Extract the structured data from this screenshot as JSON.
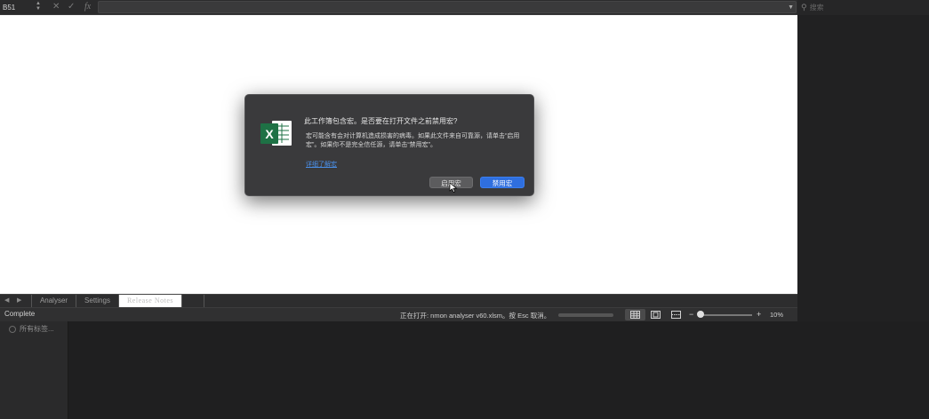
{
  "formula_bar": {
    "cell_ref": "B51",
    "stepper_glyph": "▲▼",
    "cancel_glyph": "✕",
    "confirm_glyph": "✓",
    "fx_glyph": "fx",
    "value": ""
  },
  "search": {
    "placeholder": "搜索"
  },
  "tabs": [
    {
      "label": "Analyser"
    },
    {
      "label": "Settings"
    },
    {
      "label": "Release Notes"
    }
  ],
  "status_bar": {
    "status": "Complete",
    "opening_message": "正在打开: nmon analyser v60.xlsm。按 Esc 取消。",
    "zoom_minus": "−",
    "zoom_plus": "+",
    "zoom_level": "10%"
  },
  "sidebar": {
    "item_label": "所有标签..."
  },
  "dialog": {
    "title": "此工作簿包含宏。是否要在打开文件之前禁用宏?",
    "body": "宏可能含有会对计算机造成损害的病毒。如果此文件来自可靠源，请单击“启用宏”。如果你不是完全信任源，请单击“禁用宏”。",
    "link": "详细了解宏",
    "enable_button": "启用宏",
    "disable_button": "禁用宏",
    "app_icon_letter": "X"
  },
  "colors": {
    "accent": "#2f6fdf",
    "excel_green": "#1e7145",
    "link": "#4a8fe8"
  }
}
